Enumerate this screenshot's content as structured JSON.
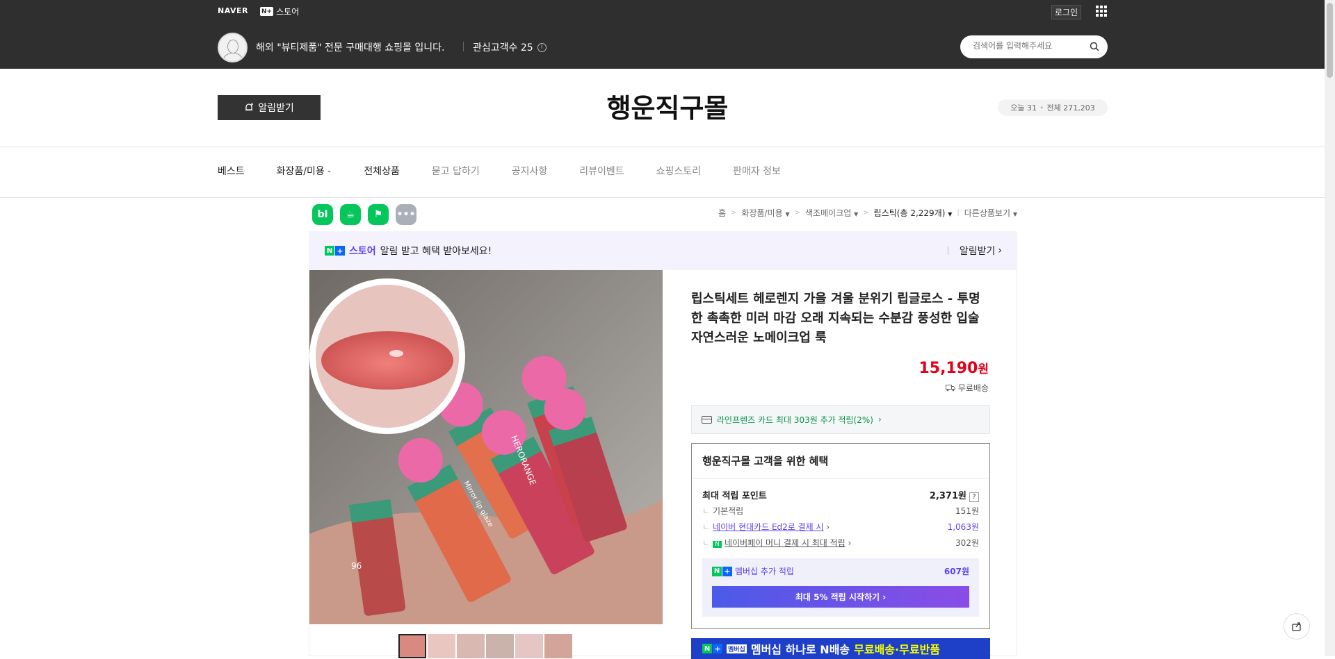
{
  "top": {
    "naver": "NAVER",
    "nstore_badge": "N+",
    "nstore": "스토어",
    "login": "로그인",
    "store_desc": "해외 \"뷰티제품\" 전문 구매대행 쇼핑몰 입니다.",
    "interest_label": "관심고객수 25",
    "search_placeholder": "검색어를 입력해주세요"
  },
  "header": {
    "alarm": "알림받기",
    "store_name": "행운직구몰",
    "today": "오늘 31",
    "total": "전체 271,203"
  },
  "nav": [
    {
      "label": "베스트"
    },
    {
      "label": "화장품/미용"
    },
    {
      "label": "전체상품"
    },
    {
      "label": "묻고 답하기"
    },
    {
      "label": "공지사항"
    },
    {
      "label": "리뷰이벤트"
    },
    {
      "label": "쇼핑스토리"
    },
    {
      "label": "판매자 정보"
    }
  ],
  "breadcrumb": {
    "home": "홈",
    "c1": "화장품/미용",
    "c2": "색조메이크업",
    "c3": "립스틱(총 2,229개)",
    "other": "다른상품보기"
  },
  "promo": {
    "store": "스토어",
    "text": "알림 받고 혜택 받아보세요!",
    "right": "알림받기"
  },
  "product": {
    "title": "립스틱세트 헤로렌지 가을 겨울 분위기 립글로스 - 투명한 촉촉한 미러 마감 오래 지속되는 수분감 풍성한 입술 자연스러운 노메이크업 룩",
    "price": "15,190",
    "won": "원",
    "shipping": "무료배송",
    "card_benefit": "라인프렌즈 카드 최대 303원 추가 적립(2%)",
    "image_texts": [
      "HERORANGE",
      "Mirror lip glaze",
      "96"
    ]
  },
  "benefit": {
    "title": "행운직구몰 고객을 위한 혜택",
    "max_label": "최대 적립 포인트",
    "max_val": "2,371원",
    "basic_label": "기본적립",
    "basic_val": "151원",
    "card_label": "네이버 현대카드 Ed2로 결제 시",
    "card_val": "1,063원",
    "pay_label": "네이버페이 머니 결제 시 최대 적립",
    "pay_val": "302원",
    "membership_label": "멤버십 추가 적립",
    "membership_val": "607원",
    "membership_btn": "최대 5% 적립 시작하기",
    "banner_tag": "멤버십",
    "banner_text": "멤버십 하나로 N배송",
    "banner_yellow": "무료배송·무료반품"
  }
}
